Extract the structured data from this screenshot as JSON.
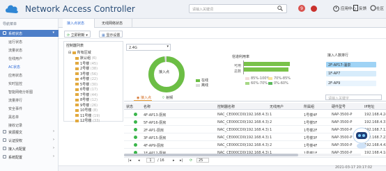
{
  "header": {
    "title": "Network Access Controller",
    "search_placeholder": "请输入关键词",
    "notification_count": "9",
    "help": "应用中心",
    "feedback": "反馈",
    "community": "社区"
  },
  "sidebar": {
    "header": "导航菜单",
    "sections": [
      {
        "label": "系统状态",
        "active": true
      },
      {
        "label": "资源报文"
      },
      {
        "label": "认证授权"
      },
      {
        "label": "接入点配置"
      },
      {
        "label": "系统配置"
      }
    ],
    "items": [
      "运行状态",
      "流量状态",
      "在线用户",
      "AC状态",
      "应用状态",
      "实时监控",
      "智能网络分析图",
      "流量排行",
      "安全事件",
      "黑名单",
      "接收记录"
    ],
    "current": "AC状态"
  },
  "tabs": [
    "接入点状态",
    "无线网络状态"
  ],
  "toolbar": {
    "refresh": "立即刷新",
    "settings": "显示设置"
  },
  "tree": {
    "title": "控制器列表",
    "root": "所有区域",
    "nodes": [
      {
        "label": "默认组",
        "count": "(6)"
      },
      {
        "label": "1号楼",
        "count": "(45)"
      },
      {
        "label": "2号楼",
        "count": "(38)"
      },
      {
        "label": "3号楼",
        "count": "(56)"
      },
      {
        "label": "4号楼",
        "count": "(22)"
      },
      {
        "label": "5号楼",
        "count": "(30)"
      },
      {
        "label": "6号楼",
        "count": "(17)"
      },
      {
        "label": "7号楼",
        "count": "(44)"
      },
      {
        "label": "8号楼",
        "count": "(12)"
      },
      {
        "label": "9号楼",
        "count": "(26)"
      },
      {
        "label": "10号楼",
        "count": "(8)"
      },
      {
        "label": "11号楼",
        "count": "(19)"
      },
      {
        "label": "12号楼",
        "count": "(33)"
      }
    ]
  },
  "band": "2.4G",
  "donut": {
    "label": "接入点",
    "online_pct": 98,
    "legend": [
      "在线",
      "离线"
    ],
    "colors": {
      "online": "#6cbe45",
      "offline": "#d9d9d9"
    }
  },
  "channel": {
    "title": "信道利用率",
    "rows": [
      "可用",
      "总数"
    ],
    "values": [
      92,
      89
    ],
    "legend": [
      "0%-60%",
      "60%-70%",
      "70%-85%",
      "85%-100%"
    ]
  },
  "topap": {
    "title": "接入人数排行",
    "rows": [
      "2F-AP17-温泉",
      "1F-AP7",
      "2F-AP9"
    ]
  },
  "tabs2": [
    "接入点",
    "射频"
  ],
  "search2_placeholder": "请输入关键字",
  "table": {
    "headers": [
      "状态",
      "名称",
      "控制器名称",
      "无线用户",
      "所属组",
      "硬件型号",
      "IP地址"
    ],
    "rows": [
      [
        "4F-AP13-厨房",
        "NAC_CE000CD0(192.168.4.3)",
        "1",
        "1号楼4F",
        "NAP-3500-P",
        "192.168.4.24"
      ],
      [
        "5F-AP16-厨房",
        "NAC_CE000CD0(192.168.4.3)",
        "2",
        "1号楼5F",
        "NAP-3500-P",
        "192.168.4.31"
      ],
      [
        "2F-AP1-厨房",
        "NAC_CE000CD0(192.168.4.3)",
        "1",
        "1号楼2F",
        "NAP-3500-P",
        "192.168.7.12"
      ],
      [
        "3F-AP15-厨房",
        "NAC_CE000CD0(192.168.4.3)",
        "1",
        "1号楼3F",
        "NAP-3500-P",
        "192.168.7.22"
      ],
      [
        "4F-AP9-厨房",
        "NAC_CE000CD0(192.168.4.3)",
        "2",
        "1号楼4F",
        "NAP-3500-P",
        "192.168.4.42"
      ],
      [
        "1F-AP12-厨房",
        "NAC_CE000CD0(192.168.4.3)",
        "1",
        "1号楼1F",
        "NAP-3500-P",
        "192.168.4.18"
      ]
    ]
  },
  "pager": {
    "page": "1",
    "total": "/ 16",
    "size": "25"
  },
  "timestamp": "2021-03-17 20:17:02"
}
